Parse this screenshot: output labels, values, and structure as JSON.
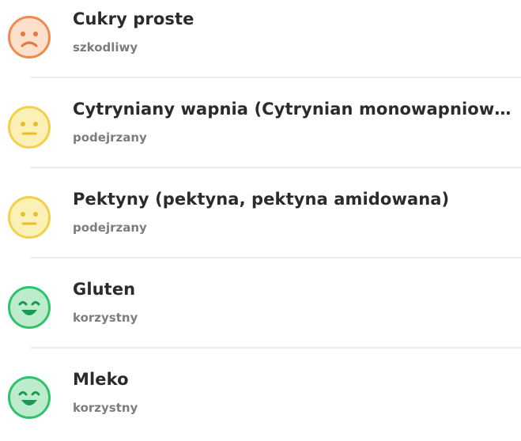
{
  "ingredients": [
    {
      "name": "Cukry proste",
      "status": "szkodliwy",
      "icon": "sad-face-icon",
      "color": "#f08a4b",
      "fill": "#fde0cc"
    },
    {
      "name": "Cytryniany wapnia (Cytrynian monowapniowy,...",
      "status": "podejrzany",
      "icon": "neutral-face-icon",
      "color": "#f2d14a",
      "fill": "#fbf1b6"
    },
    {
      "name": "Pektyny (pektyna, pektyna amidowana)",
      "status": "podejrzany",
      "icon": "neutral-face-icon",
      "color": "#f2d14a",
      "fill": "#fbf1b6"
    },
    {
      "name": "Gluten",
      "status": "korzystny",
      "icon": "happy-face-icon",
      "color": "#2ec26a",
      "fill": "#bdeccd"
    },
    {
      "name": "Mleko",
      "status": "korzystny",
      "icon": "happy-face-icon",
      "color": "#2ec26a",
      "fill": "#bdeccd"
    }
  ]
}
